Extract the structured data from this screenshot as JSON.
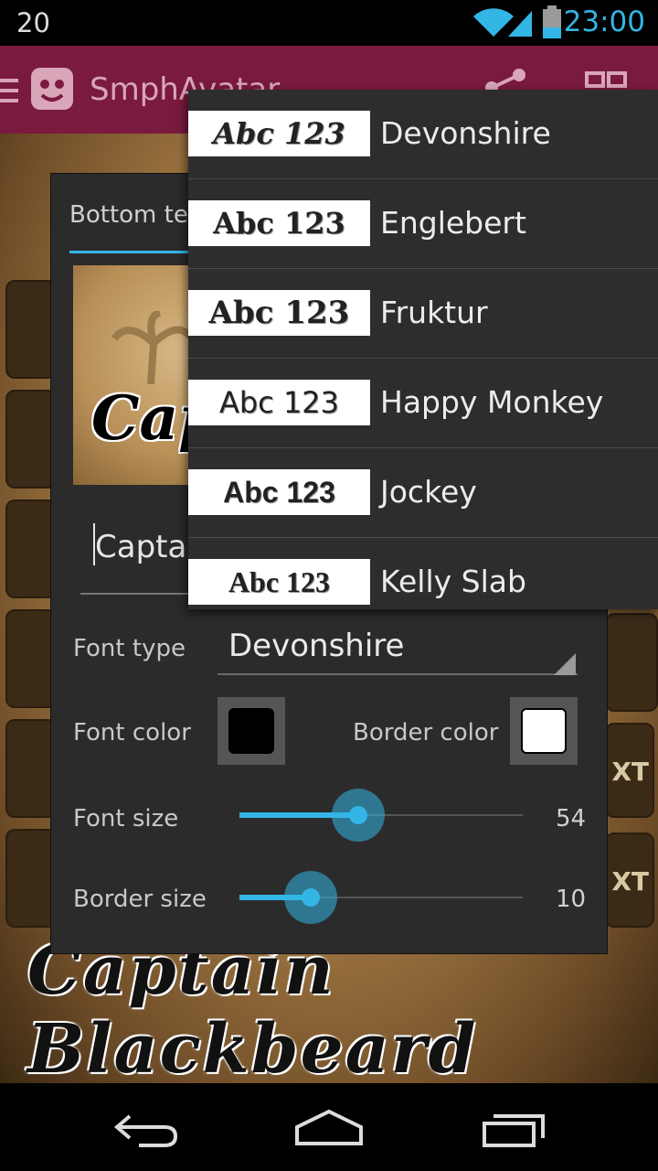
{
  "status_bar": {
    "left_text": "20",
    "time": "23:00"
  },
  "app": {
    "title": "SmphAvatar",
    "accent": "#33b5e5",
    "actionbar_color": "#7a1a3e"
  },
  "background": {
    "caption": "Captain Blackbeard",
    "right_tool_label": "XT"
  },
  "dialog": {
    "tab_label": "Bottom text",
    "preview_text": "Captain Blackbeard",
    "text_value": "Captain Blackbeard",
    "font_type_label": "Font type",
    "font_type_value": "Devonshire",
    "font_color_label": "Font color",
    "font_color": "#000000",
    "border_color_label": "Border color",
    "border_color": "#ffffff",
    "font_size_label": "Font size",
    "font_size_value": "54",
    "font_size_fraction": 0.42,
    "border_size_label": "Border size",
    "border_size_value": "10",
    "border_size_fraction": 0.25
  },
  "dropdown": {
    "sample_text": "Abc 123",
    "options": [
      {
        "name": "Devonshire"
      },
      {
        "name": "Englebert"
      },
      {
        "name": "Fruktur"
      },
      {
        "name": "Happy Monkey"
      },
      {
        "name": "Jockey"
      },
      {
        "name": "Kelly Slab"
      }
    ]
  },
  "icons": [
    "menu-icon",
    "app-logo-icon",
    "share-icon",
    "gallery-icon",
    "wifi-icon",
    "signal-icon",
    "battery-icon",
    "back-icon",
    "home-icon",
    "recents-icon"
  ]
}
